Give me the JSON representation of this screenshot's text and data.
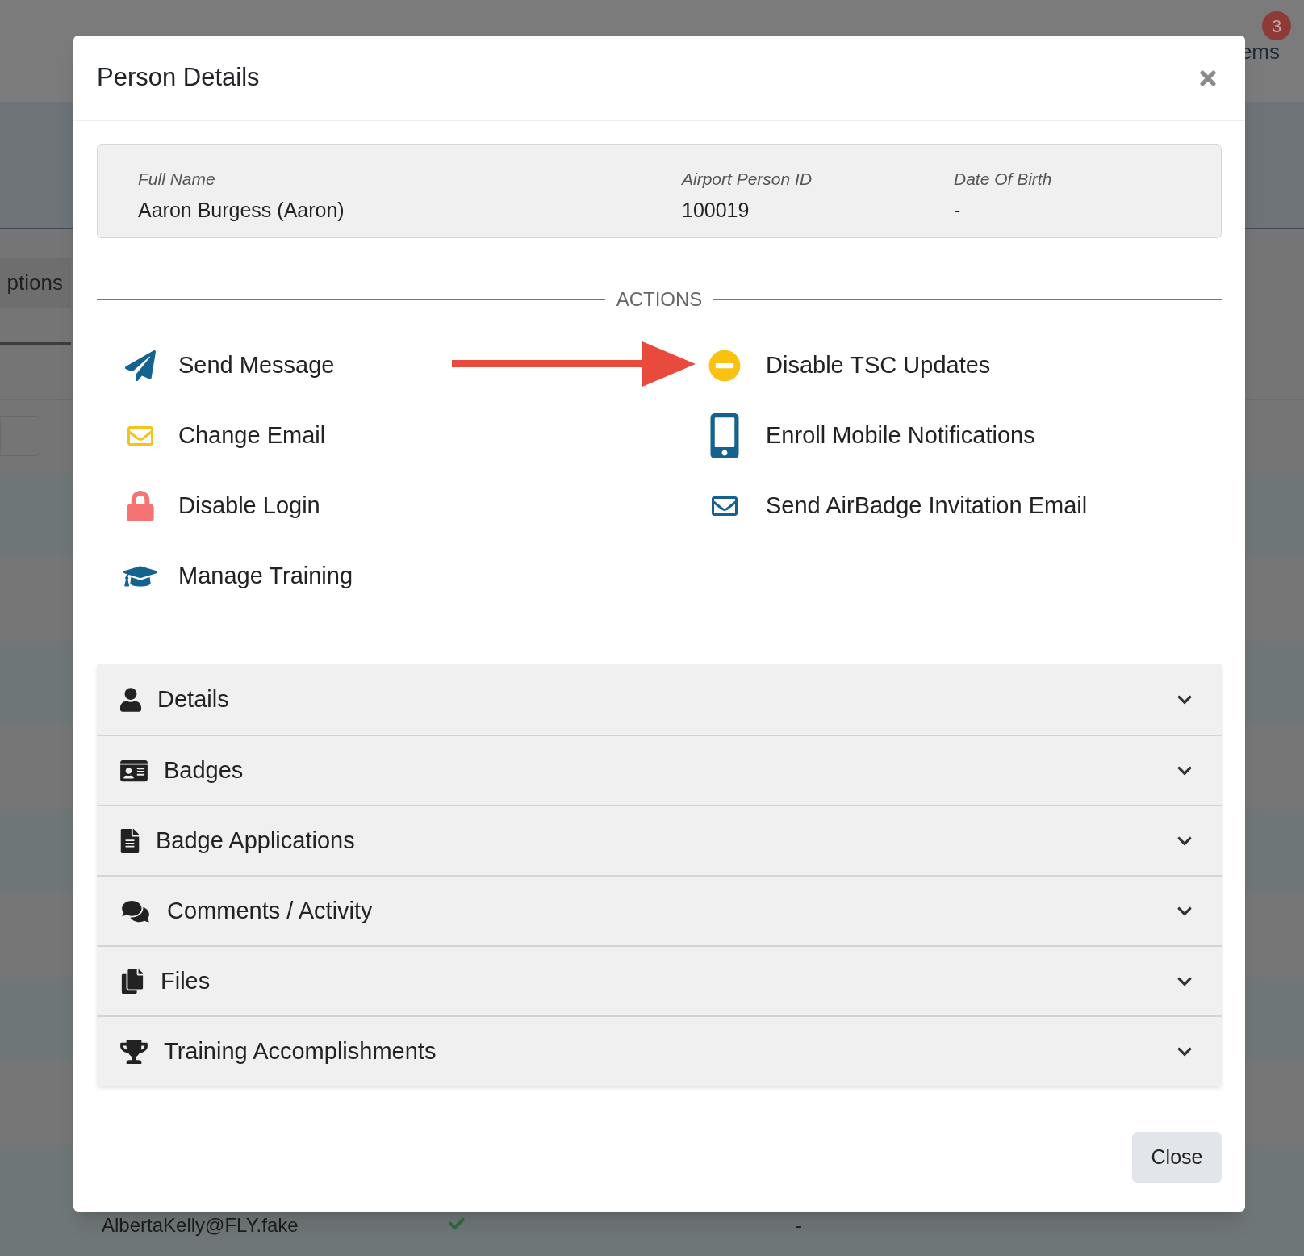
{
  "background_page": {
    "header_text": "ems",
    "notification_count": "3",
    "tab_label": "ptions",
    "row_email": "AlbertaKelly@FLY.fake",
    "row_value": "-"
  },
  "dialog": {
    "title": "Person Details",
    "summary": [
      {
        "label": "Full Name",
        "value": "Aaron Burgess (Aaron)"
      },
      {
        "label": "Airport Person ID",
        "value": "100019"
      },
      {
        "label": "Date Of Birth",
        "value": "-"
      }
    ],
    "actions_heading": "ACTIONS",
    "actions_left": [
      {
        "kind": "send",
        "label": "Send Message"
      },
      {
        "kind": "email",
        "label": "Change Email"
      },
      {
        "kind": "lock",
        "label": "Disable Login"
      },
      {
        "kind": "training",
        "label": "Manage Training"
      }
    ],
    "actions_right": [
      {
        "kind": "disable",
        "label": "Disable TSC Updates"
      },
      {
        "kind": "mobile",
        "label": "Enroll Mobile Notifications"
      },
      {
        "kind": "invite",
        "label": "Send AirBadge Invitation Email"
      }
    ],
    "sections": [
      {
        "kind": "person",
        "label": "Details",
        "expanded": false
      },
      {
        "kind": "badge",
        "label": "Badges",
        "expanded": false
      },
      {
        "kind": "file",
        "label": "Badge Applications",
        "expanded": false
      },
      {
        "kind": "comments",
        "label": "Comments / Activity",
        "expanded": false
      },
      {
        "kind": "files",
        "label": "Files",
        "expanded": false
      },
      {
        "kind": "trophy",
        "label": "Training Accomplishments",
        "expanded": false
      }
    ],
    "close_button": "Close"
  }
}
